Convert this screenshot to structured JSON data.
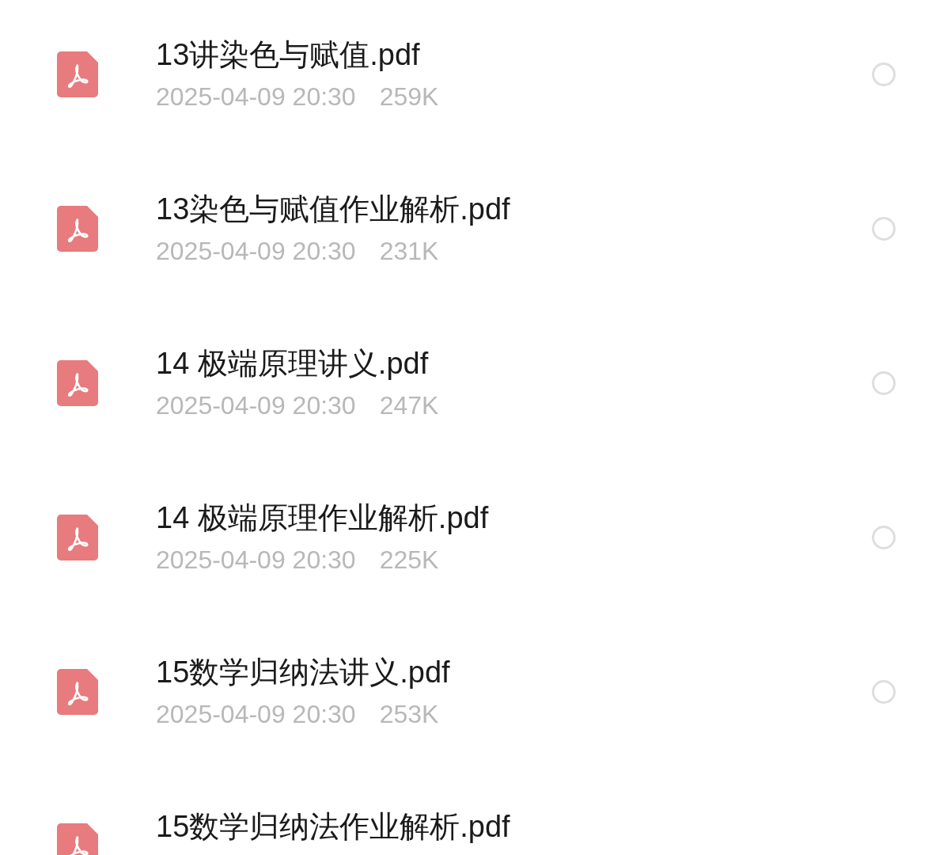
{
  "files": [
    {
      "name": "13讲染色与赋值.pdf",
      "date": "2025-04-09 20:30",
      "size": "259K",
      "selected": false
    },
    {
      "name": "13染色与赋值作业解析.pdf",
      "date": "2025-04-09 20:30",
      "size": "231K",
      "selected": false
    },
    {
      "name": "14 极端原理讲义.pdf",
      "date": "2025-04-09 20:30",
      "size": "247K",
      "selected": false
    },
    {
      "name": "14 极端原理作业解析.pdf",
      "date": "2025-04-09 20:30",
      "size": "225K",
      "selected": false
    },
    {
      "name": "15数学归纳法讲义.pdf",
      "date": "2025-04-09 20:30",
      "size": "253K",
      "selected": false
    },
    {
      "name": "15数学归纳法作业解析.pdf"
    }
  ]
}
